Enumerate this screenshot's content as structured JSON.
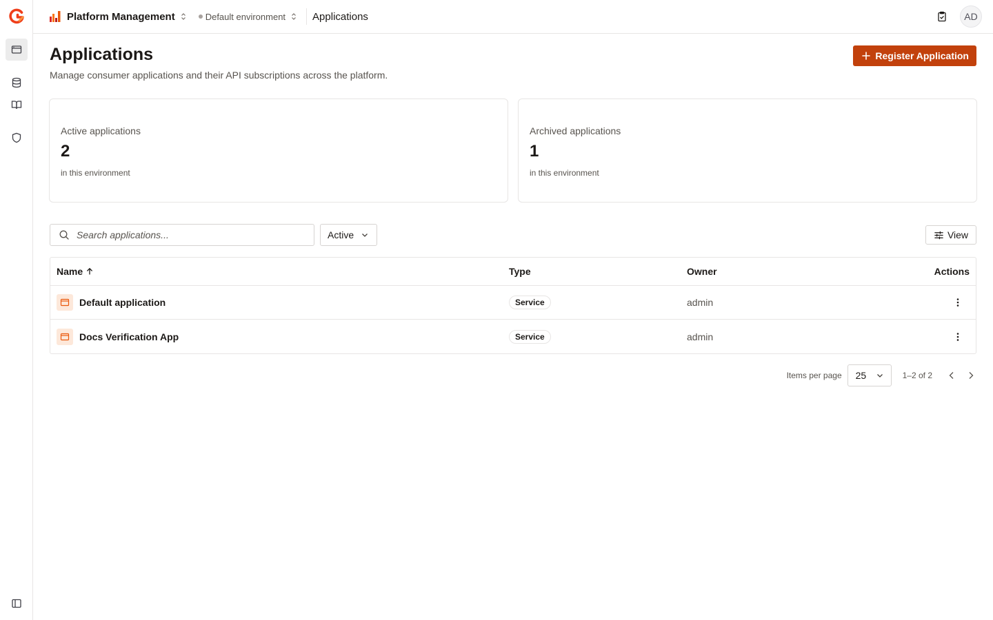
{
  "rail": {
    "items": [
      "applications-icon",
      "database-icon",
      "book-open-icon",
      "shield-icon"
    ],
    "collapse_icon": "sidebar-toggle-icon"
  },
  "topbar": {
    "org_name": "Platform Management",
    "environment": "Default environment",
    "breadcrumb": "Applications",
    "avatar_initials": "AD"
  },
  "header": {
    "title": "Applications",
    "description": "Manage consumer applications and their API subscriptions across the platform.",
    "register_label": "Register Application"
  },
  "stats": [
    {
      "label": "Active applications",
      "value": "2",
      "sub": "in this environment"
    },
    {
      "label": "Archived applications",
      "value": "1",
      "sub": "in this environment"
    }
  ],
  "toolbar": {
    "search_placeholder": "Search applications...",
    "filter_value": "Active",
    "view_label": "View"
  },
  "table": {
    "columns": {
      "name": "Name",
      "type": "Type",
      "owner": "Owner",
      "actions": "Actions"
    },
    "rows": [
      {
        "name": "Default application",
        "type": "Service",
        "owner": "admin"
      },
      {
        "name": "Docs Verification App",
        "type": "Service",
        "owner": "admin"
      }
    ]
  },
  "pagination": {
    "items_per_page_label": "Items per page",
    "items_per_page": "25",
    "range": "1–2 of 2"
  },
  "colors": {
    "accent": "#c2410c",
    "app_icon_bg": "#fde8da",
    "app_icon_fg": "#ea580c"
  }
}
